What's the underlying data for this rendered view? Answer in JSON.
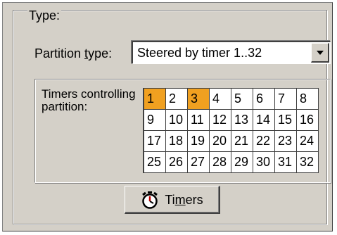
{
  "group": {
    "legend": "Type:"
  },
  "partition_type": {
    "label_pre": "Partition ",
    "label_accel": "t",
    "label_post": "ype:",
    "value": "Steered by timer 1..32"
  },
  "timers": {
    "label": "Timers controlling partition:",
    "cells": [
      {
        "n": "1",
        "selected": true
      },
      {
        "n": "2",
        "selected": false
      },
      {
        "n": "3",
        "selected": true
      },
      {
        "n": "4",
        "selected": false
      },
      {
        "n": "5",
        "selected": false
      },
      {
        "n": "6",
        "selected": false
      },
      {
        "n": "7",
        "selected": false
      },
      {
        "n": "8",
        "selected": false
      },
      {
        "n": "9",
        "selected": false
      },
      {
        "n": "10",
        "selected": false
      },
      {
        "n": "11",
        "selected": false
      },
      {
        "n": "12",
        "selected": false
      },
      {
        "n": "13",
        "selected": false
      },
      {
        "n": "14",
        "selected": false
      },
      {
        "n": "15",
        "selected": false
      },
      {
        "n": "16",
        "selected": false
      },
      {
        "n": "17",
        "selected": false
      },
      {
        "n": "18",
        "selected": false
      },
      {
        "n": "19",
        "selected": false
      },
      {
        "n": "20",
        "selected": false
      },
      {
        "n": "21",
        "selected": false
      },
      {
        "n": "22",
        "selected": false
      },
      {
        "n": "23",
        "selected": false
      },
      {
        "n": "24",
        "selected": false
      },
      {
        "n": "25",
        "selected": false
      },
      {
        "n": "26",
        "selected": false
      },
      {
        "n": "27",
        "selected": false
      },
      {
        "n": "28",
        "selected": false
      },
      {
        "n": "29",
        "selected": false
      },
      {
        "n": "30",
        "selected": false
      },
      {
        "n": "31",
        "selected": false
      },
      {
        "n": "32",
        "selected": false
      }
    ],
    "selected_color": "#f0a020"
  },
  "timers_button": {
    "label_pre": "Ti",
    "label_accel": "m",
    "label_post": "ers",
    "icon": "stopwatch-icon"
  }
}
